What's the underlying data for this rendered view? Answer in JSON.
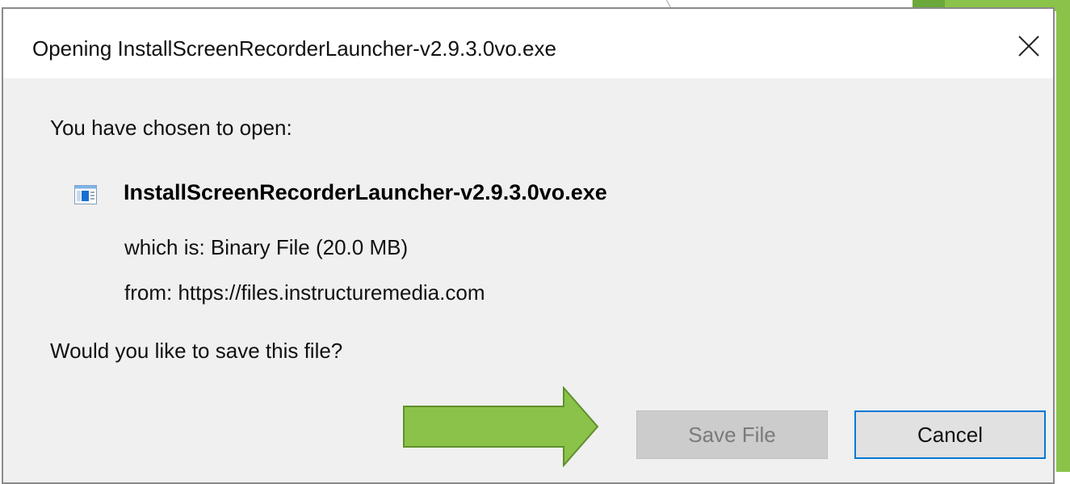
{
  "dialog": {
    "title": "Opening InstallScreenRecorderLauncher-v2.9.3.0vo.exe",
    "close_icon": "close-icon",
    "prompt_open": "You have chosen to open:",
    "file": {
      "icon": "application-file-icon",
      "name": "InstallScreenRecorderLauncher-v2.9.3.0vo.exe",
      "which_is": "which is: Binary File (20.0 MB)",
      "from": "from: https://files.instructuremedia.com"
    },
    "prompt_save": "Would you like to save this file?",
    "buttons": {
      "save_file": "Save File",
      "cancel": "Cancel"
    }
  },
  "annotation": {
    "arrow": "right-arrow-icon",
    "arrow_color": "#8bc34a"
  },
  "colors": {
    "accent_focus": "#0078d7",
    "dialog_bg": "#f0f0f0",
    "titlebar_bg": "#ffffff"
  }
}
